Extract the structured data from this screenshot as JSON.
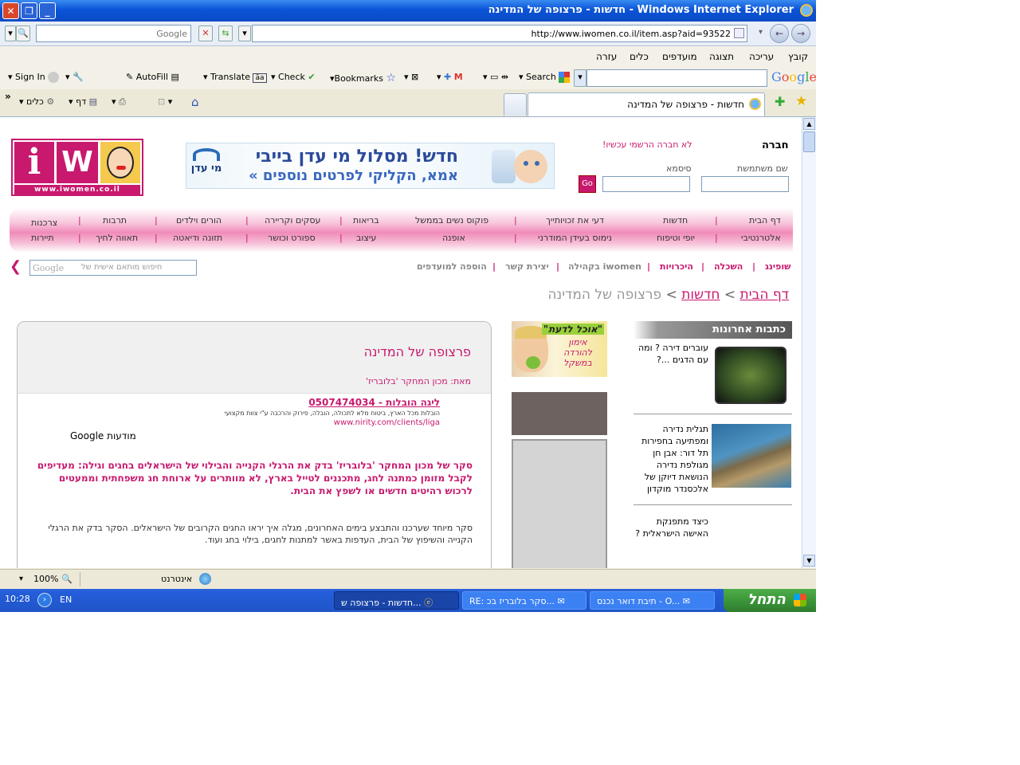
{
  "window": {
    "title": "חדשות - פרצופה של המדינה - Windows Internet Explorer"
  },
  "address": {
    "search_placeholder": "Google",
    "url": "http://www.iwomen.co.il/item.asp?aid=93522"
  },
  "menu": [
    "קובץ",
    "עריכה",
    "תצוגה",
    "מועדפים",
    "כלים",
    "עזרה"
  ],
  "google_toolbar": {
    "brand": "Google",
    "search_label": "Search",
    "bookmarks": "Bookmarks",
    "check": "Check",
    "translate": "Translate",
    "autofill": "AutoFill",
    "sign_in": "Sign In"
  },
  "tab": {
    "label": "חדשות - פרצופה של המדינה",
    "page_menu": "דף",
    "tools_menu": "כלים"
  },
  "site": {
    "logo_text": "www.iwomen.co.il",
    "logo_letters": "iW",
    "banner_line1": "חדש! מסלול מי עדן בייבי",
    "banner_line2": "אמא, הקליקי לפרטים נוספים »",
    "banner_brand": "מי עדן",
    "login": {
      "title": "חברה",
      "register_link": "לא חברה הרשמי עכשיו!",
      "username_label": "שם משתמשת",
      "password_label": "סיסמא",
      "go_label": "Go"
    },
    "nav_row1": [
      "דף הבית",
      "חדשות",
      "דעי את זכויותייך",
      "פוקוס נשים בממשל",
      "בריאות",
      "עסקים וקריירה",
      "הורים וילדים",
      "תרבות",
      "צרכנות"
    ],
    "nav_row2": [
      "אלטרנטיבי",
      "יופי וטיפוח",
      "נימוס בעידן המודרני",
      "אופנה",
      "עיצוב",
      "ספורט וכושר",
      "תזונה ודיאטה",
      "תאווה לחיך",
      "תיירות"
    ],
    "subnav": [
      "שופינג",
      "השכלה",
      "היכרויות",
      "בקהילה iwomen",
      "יצירת קשר",
      "הוספה למועדפים"
    ],
    "search_placeholder": "חיפוש מותאם אישית של",
    "search_brand": "Google",
    "breadcrumb": {
      "home": "דף הבית",
      "section": "חדשות",
      "sep": ">",
      "current": "פרצופה של המדינה"
    },
    "article": {
      "title": "פרצופה של המדינה",
      "byline": "מאת: מכון המחקר 'בלובריז'",
      "ad_title": "ליגה הובלות - 0507474034",
      "ad_desc": "הובלות מכל הארץ, ביטוח מלא לתכולה, הובלה, פירוק והרכבה ע\"י צוות מקצועי",
      "ad_url": "www.nirity.com/clients/liga",
      "ads_label": "מודעות Google",
      "lead": "סקר של מכון המחקר 'בלובריז' בדק את הרגלי הקנייה והבילוי של הישראלים בחגים וגילה: מעדיפים לקבל מזומן כמתנה לחג, מתכננים לטייל בארץ, לא מוותרים על ארוחת חג משפחתית וממעטים לרכוש רהיטים חדשים או לשפץ את הבית.",
      "body": "סקר מיוחד שערכנו והתבצע בימים האחרונים, מגלה איך יראו החגים הקרובים של הישראלים. הסקר בדק את הרגלי הקנייה והשיפוץ של הבית, העדפות באשר למתנות לחגים, בילוי בחג ועוד."
    },
    "side_ad": {
      "title": "\"אוכל לדעת\"",
      "text": "אימון להורדה במשקל"
    },
    "latest": {
      "header": "כתבות אחרונות",
      "items": [
        "עוברים דירה ? ומה עם הדגים ...?",
        "תגלית נדירה ומפתיעה בחפירות תל דור: אבן חן מגולפת נדירה הנושאת דיוקן של אלכסנדר מוקדון",
        "כיצד מתפנקת האישה הישראלית ?"
      ]
    }
  },
  "status": {
    "zone": "אינטרנט",
    "zoom": "100%"
  },
  "taskbar": {
    "start": "התחל",
    "tasks": [
      "תיבת דואר נכנס - O...",
      "RE: סקר בלובריז בכ...",
      "חדשות - פרצופה ש..."
    ],
    "lang": "EN",
    "clock": "10:28"
  }
}
